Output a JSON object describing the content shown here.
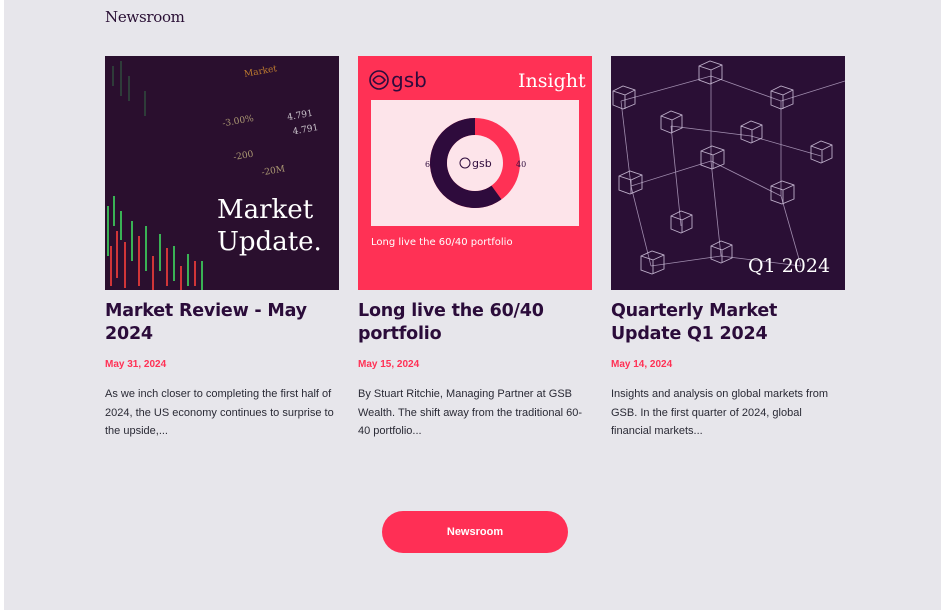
{
  "section": {
    "title": "Newsroom"
  },
  "cards": [
    {
      "title": "Market Review - May 2024",
      "date": "May 31, 2024",
      "excerpt": "As we inch closer to completing the first half of 2024, the US economy continues to surprise to the upside,...",
      "image": {
        "overlay_line1": "Market",
        "overlay_line2": "Update.",
        "ticker_labels": [
          "Market",
          "-3.00%",
          "4.791",
          "4.791",
          "-200",
          "-20M"
        ]
      }
    },
    {
      "title": "Long live the 60/40 portfolio",
      "date": "May 15, 2024",
      "excerpt": "By Stuart Ritchie, Managing Partner at GSB Wealth. The shift away from the traditional 60-40 portfolio...",
      "image": {
        "brand": "gsb",
        "badge": "Insight",
        "left_value": "60",
        "right_value": "40",
        "center_brand": "gsb",
        "caption": "Long live the 60/40 portfolio"
      }
    },
    {
      "title": "Quarterly Market Update Q1 2024",
      "date": "May 14, 2024",
      "excerpt": "Insights and analysis on global markets from GSB. In the first quarter of 2024, global financial markets...",
      "image": {
        "overlay": "Q1 2024"
      }
    }
  ],
  "button": {
    "label": "Newsroom"
  },
  "colors": {
    "accent": "#ff2f55",
    "heading": "#2b0c3a",
    "background": "#e7e6eb",
    "donut_dark": "#2e0b3c",
    "donut_light": "#ff3155"
  }
}
